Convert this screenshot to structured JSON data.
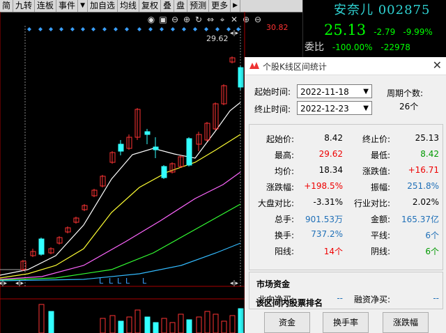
{
  "toolbar": {
    "items": [
      "简",
      "九转",
      "连板",
      "事件",
      "加自选",
      "均线",
      "复权",
      "叠",
      "盘",
      "预测",
      "更多"
    ]
  },
  "chart": {
    "price_marker": "30.82",
    "high_label": "29.62",
    "l_markers": [
      "L",
      "L",
      "L",
      "L",
      "L"
    ],
    "colors": {
      "up": "#ff3333",
      "down": "#33ffff",
      "ma5": "#ffffff",
      "ma10": "#ffff33",
      "ma20": "#ff66ff",
      "ma30": "#33ff33",
      "ma60": "#33bbff"
    }
  },
  "quote": {
    "stock_name": "安奈儿",
    "stock_code": "002875",
    "price": "25.13",
    "change": "-2.79",
    "change_pct": "-9.99%",
    "weibi_label": "委比",
    "weibi_pct": "-100.00%",
    "weibi_val": "-22978"
  },
  "dialog": {
    "title": "个股K线区间统计",
    "start_label": "起始时间:",
    "start_date": "2022-11-18",
    "end_label": "终止时间:",
    "end_date": "2022-12-23",
    "period_label": "周期个数:",
    "period_value": "26个",
    "stats": {
      "start_price_label": "起始价:",
      "start_price": "8.42",
      "end_price_label": "终止价:",
      "end_price": "25.13",
      "high_label": "最高:",
      "high": "29.62",
      "low_label": "最低:",
      "low": "8.42",
      "avg_label": "均价:",
      "avg": "18.34",
      "change_val_label": "涨跌值:",
      "change_val": "+16.71",
      "change_pct_label": "涨跌幅:",
      "change_pct": "+198.5%",
      "amplitude_label": "振幅:",
      "amplitude": "251.8%",
      "market_cmp_label": "大盘对比:",
      "market_cmp": "-3.31%",
      "industry_cmp_label": "行业对比:",
      "industry_cmp": "2.02%",
      "volume_label": "总手:",
      "volume": "901.53万",
      "amount_label": "金额:",
      "amount": "165.37亿",
      "turnover_label": "换手:",
      "turnover": "737.2%",
      "flat_label": "平线:",
      "flat": "6个",
      "yang_label": "阳线:",
      "yang": "14个",
      "yin_label": "阴线:",
      "yin": "6个"
    },
    "funds_title": "市场资金",
    "north_label": "北向净买:",
    "north_val": "--",
    "margin_label": "融资净买:",
    "margin_val": "--",
    "rank_title": "该区间内股票排名",
    "rank_buttons": [
      "资金",
      "换手率",
      "涨跌幅"
    ]
  }
}
